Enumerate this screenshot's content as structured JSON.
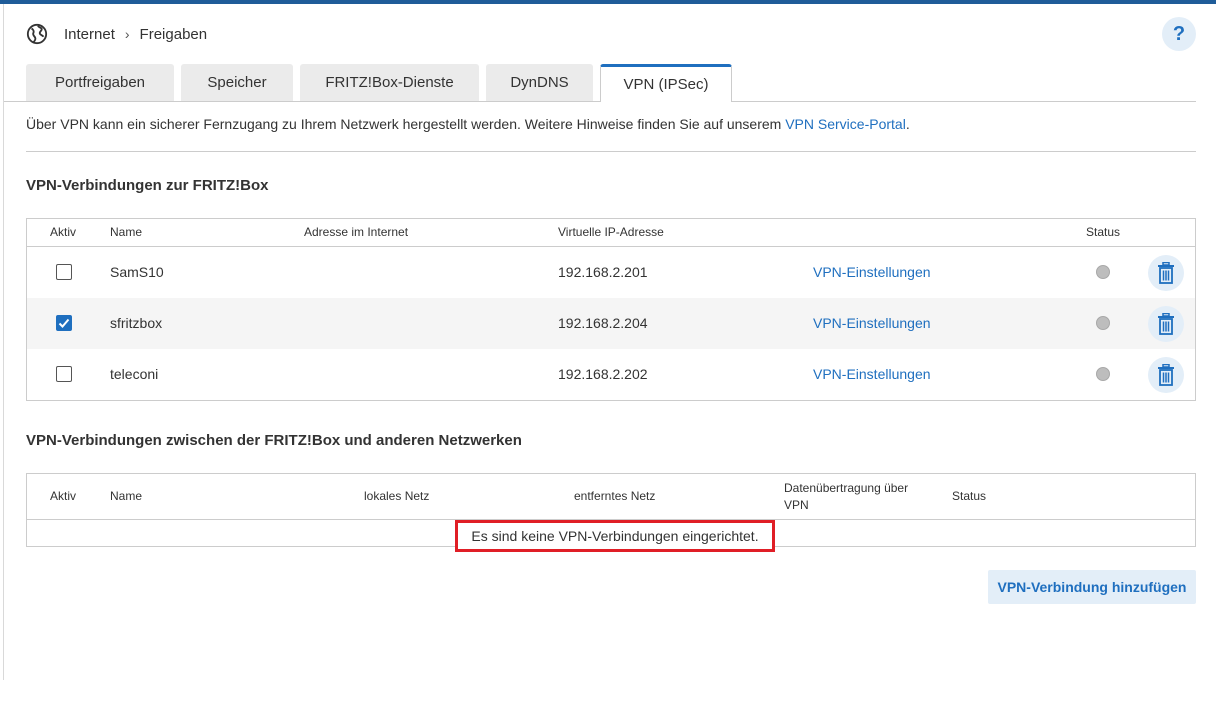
{
  "breadcrumb": {
    "items": [
      "Internet",
      "Freigaben"
    ],
    "separator": "›"
  },
  "help": {
    "label": "?"
  },
  "tabs": [
    {
      "label": "Portfreigaben",
      "active": false
    },
    {
      "label": "Speicher",
      "active": false
    },
    {
      "label": "FRITZ!Box-Dienste",
      "active": false
    },
    {
      "label": "DynDNS",
      "active": false
    },
    {
      "label": "VPN (IPSec)",
      "active": true
    }
  ],
  "intro": {
    "text": "Über VPN kann ein sicherer Fernzugang zu Ihrem Netzwerk hergestellt werden. Weitere Hinweise finden Sie auf unserem ",
    "link": "VPN Service-Portal",
    "suffix": "."
  },
  "section1": {
    "title": "VPN-Verbindungen zur FRITZ!Box",
    "headers": {
      "active": "Aktiv",
      "name": "Name",
      "address": "Adresse im Internet",
      "virtual_ip": "Virtuelle IP-Adresse",
      "status": "Status"
    },
    "rows": [
      {
        "active": false,
        "name": "SamS10",
        "address": "",
        "virtual_ip": "192.168.2.201",
        "settings_link": "VPN-Einstellungen",
        "status": "inactive"
      },
      {
        "active": true,
        "name": "sfritzbox",
        "address": "",
        "virtual_ip": "192.168.2.204",
        "settings_link": "VPN-Einstellungen",
        "status": "inactive"
      },
      {
        "active": false,
        "name": "teleconi",
        "address": "",
        "virtual_ip": "192.168.2.202",
        "settings_link": "VPN-Einstellungen",
        "status": "inactive"
      }
    ]
  },
  "section2": {
    "title": "VPN-Verbindungen zwischen der FRITZ!Box und anderen Netzwerken",
    "headers": {
      "active": "Aktiv",
      "name": "Name",
      "local": "lokales Netz",
      "remote": "entferntes Netz",
      "transfer_line1": "Datenübertragung über",
      "transfer_line2": "VPN",
      "status": "Status"
    },
    "empty_message": "Es sind keine VPN-Verbindungen eingerichtet."
  },
  "add_button": {
    "label": "VPN-Verbindung hinzufügen"
  },
  "colors": {
    "accent": "#1f6fbf",
    "topbar": "#1f5c99",
    "highlight": "#e01e26",
    "button_bg": "#e3eef8"
  },
  "icons": {
    "globe": "globe-icon",
    "trash": "trash-icon",
    "check": "check-icon",
    "help": "help-icon"
  }
}
